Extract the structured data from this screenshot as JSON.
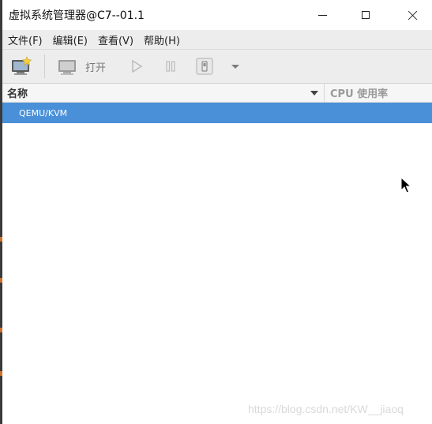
{
  "window": {
    "title": "虚拟系统管理器@C7--01.1"
  },
  "menubar": {
    "items": [
      {
        "label": "文件(F)"
      },
      {
        "label": "编辑(E)"
      },
      {
        "label": "查看(V)"
      },
      {
        "label": "帮助(H)"
      }
    ]
  },
  "toolbar": {
    "open_label": "打开",
    "icons": [
      "new-vm-icon",
      "monitor-icon",
      "run-icon",
      "pause-icon",
      "shutdown-icon",
      "dropdown-arrow-icon"
    ]
  },
  "list": {
    "columns": [
      {
        "label": "名称"
      },
      {
        "label": "CPU 使用率"
      }
    ],
    "rows": [
      {
        "name": "QEMU/KVM",
        "selected": true
      }
    ]
  },
  "watermark": "https://blog.csdn.net/KW__jiaoq",
  "colors": {
    "selection": "#4a90d9",
    "menubar_bg": "#ededed",
    "accent_orange": "#d07028"
  }
}
